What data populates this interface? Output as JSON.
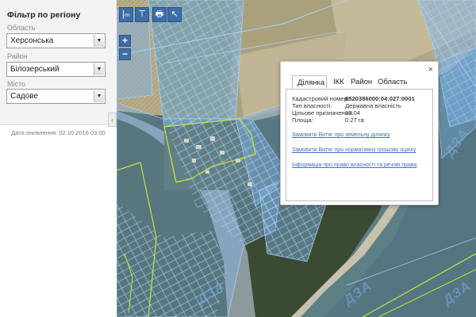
{
  "filter": {
    "title": "Фільтр по регіону",
    "fields": [
      {
        "label": "Область",
        "value": "Херсонська"
      },
      {
        "label": "Район",
        "value": "Білозерський"
      },
      {
        "label": "Місто",
        "value": "Садове"
      }
    ],
    "update_date": "Дата оновлення: 02.10.2016 03:00",
    "collapse_glyph": "‹"
  },
  "toolbar": {
    "tools": [
      {
        "icon": "measure-length-icon",
        "glyph": "|ₘ"
      },
      {
        "icon": "measure-area-icon",
        "glyph": "⊤"
      },
      {
        "icon": "print-icon",
        "glyph": "🖶"
      },
      {
        "icon": "select-pointer-icon",
        "glyph": "↖"
      }
    ],
    "zoom_in": "+",
    "zoom_out": "−"
  },
  "popup": {
    "close_glyph": "×",
    "tabs": [
      "Ділянка",
      "ІКК",
      "Район",
      "Область"
    ],
    "active_tab": "Ділянка",
    "properties": [
      {
        "label": "Кадастровий номер:",
        "value": "6520386000:04:027:0001"
      },
      {
        "label": "Тип власності:",
        "value": "Державна власність"
      },
      {
        "label": "Цільове призначення:",
        "value": "10.04"
      },
      {
        "label": "Площа:",
        "value": "0.27 га"
      }
    ],
    "links": [
      "Замовити Витяг про земельну ділянку",
      "Замовити Витяг про нормативну грошову оцінку",
      "Інформація про право власності та речові права"
    ]
  },
  "map": {
    "watermark": "ДЗА",
    "colors": {
      "parcel_fill": "#7fb2e6",
      "parcel_stroke": "#a8d0f5",
      "boundary_green": "#c8e43a",
      "water": "#5d7f86"
    }
  }
}
